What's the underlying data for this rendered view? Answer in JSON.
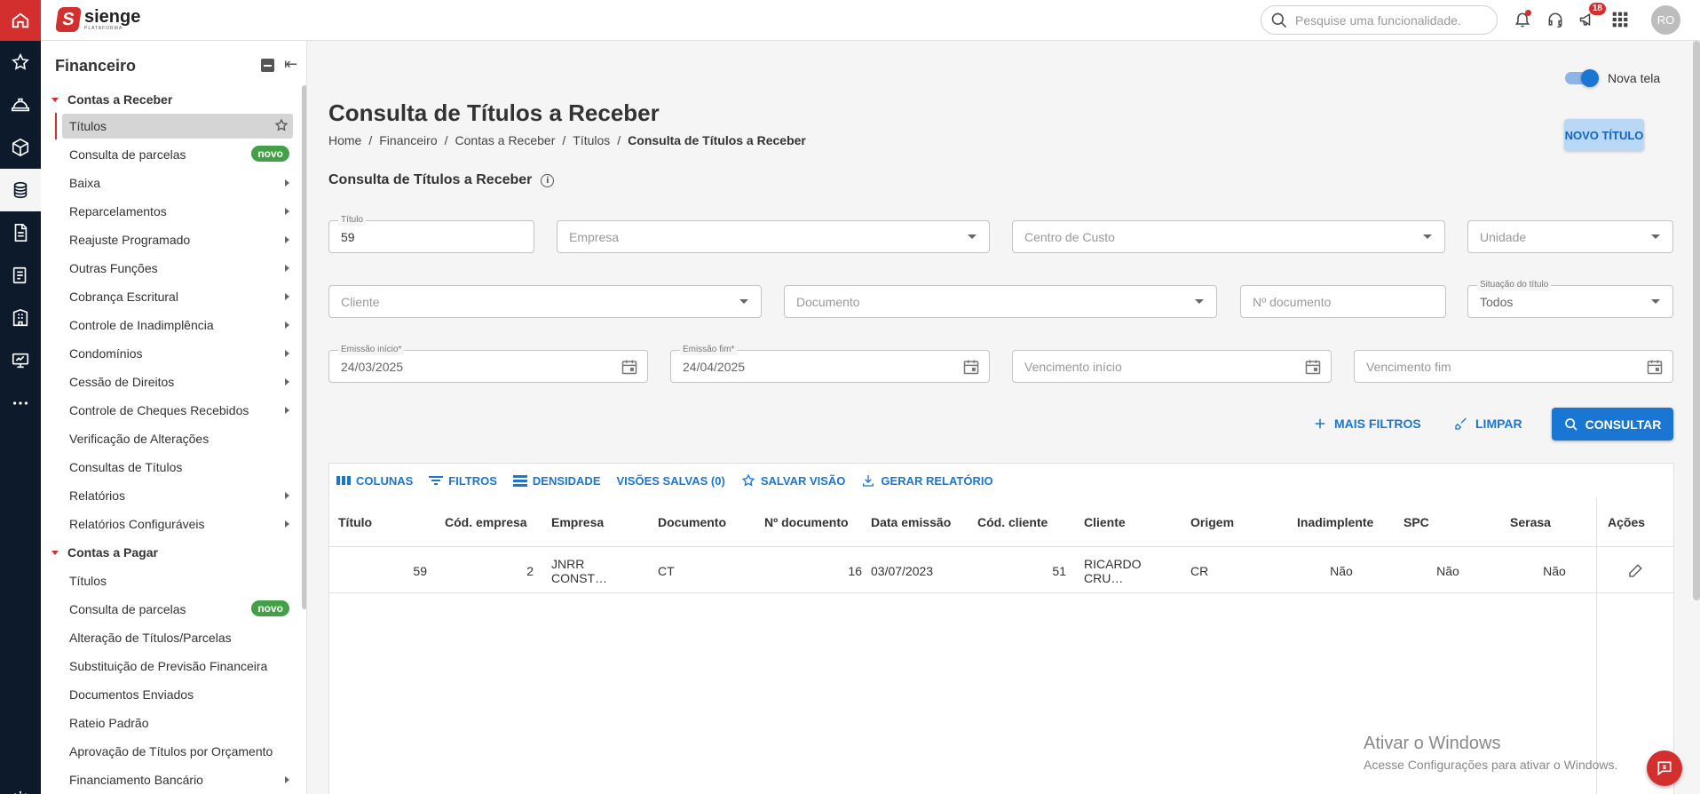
{
  "brand": {
    "name": "sienge",
    "tag": "PLATAFORMA",
    "logo_letter": "S"
  },
  "topbar": {
    "search_placeholder": "Pesquise uma funcionalidade.",
    "announcements_count": "18",
    "avatar_initials": "RO"
  },
  "sidebar": {
    "title": "Financeiro",
    "receber": {
      "label": "Contas a Receber",
      "items": [
        {
          "label": "Títulos"
        },
        {
          "label": "Consulta de parcelas",
          "badge": "novo"
        },
        {
          "label": "Baixa"
        },
        {
          "label": "Reparcelamentos"
        },
        {
          "label": "Reajuste Programado"
        },
        {
          "label": "Outras Funções"
        },
        {
          "label": "Cobrança Escritural"
        },
        {
          "label": "Controle de Inadimplência"
        },
        {
          "label": "Condomínios"
        },
        {
          "label": "Cessão de Direitos"
        },
        {
          "label": "Controle de Cheques Recebidos"
        },
        {
          "label": "Verificação de Alterações"
        },
        {
          "label": "Consultas de Títulos"
        },
        {
          "label": "Relatórios"
        },
        {
          "label": "Relatórios Configuráveis"
        }
      ]
    },
    "pagar": {
      "label": "Contas a Pagar",
      "items": [
        {
          "label": "Títulos"
        },
        {
          "label": "Consulta de parcelas",
          "badge": "novo"
        },
        {
          "label": "Alteração de Títulos/Parcelas"
        },
        {
          "label": "Substituição de Previsão Financeira"
        },
        {
          "label": "Documentos Enviados"
        },
        {
          "label": "Rateio Padrão"
        },
        {
          "label": "Aprovação de Títulos por Orçamento"
        },
        {
          "label": "Financiamento Bancário"
        }
      ]
    }
  },
  "page": {
    "toggle_label": "Nova tela",
    "title": "Consulta de Títulos a Receber",
    "breadcrumb": [
      "Home",
      "Financeiro",
      "Contas a Receber",
      "Títulos",
      "Consulta de Títulos a Receber"
    ],
    "new_button": "NOVO TÍTULO",
    "section_title": "Consulta de Títulos a Receber"
  },
  "filters": {
    "titulo": {
      "label": "Título",
      "value": "59"
    },
    "empresa": {
      "placeholder": "Empresa"
    },
    "centro_custo": {
      "placeholder": "Centro de Custo"
    },
    "unidade": {
      "placeholder": "Unidade"
    },
    "cliente": {
      "placeholder": "Cliente"
    },
    "documento": {
      "placeholder": "Documento"
    },
    "n_documento": {
      "placeholder": "Nº documento"
    },
    "situacao": {
      "label": "Situação do título",
      "value": "Todos"
    },
    "emissao_inicio": {
      "label": "Emissão início*",
      "value": "24/03/2025"
    },
    "emissao_fim": {
      "label": "Emissão fim*",
      "value": "24/04/2025"
    },
    "vencimento_inicio": {
      "placeholder": "Vencimento início"
    },
    "vencimento_fim": {
      "placeholder": "Vencimento fim"
    }
  },
  "actions": {
    "more_filters": "MAIS FILTROS",
    "clear": "LIMPAR",
    "search": "CONSULTAR"
  },
  "grid": {
    "toolbar": {
      "columns": "COLUNAS",
      "filters": "FILTROS",
      "density": "DENSIDADE",
      "saved_views": "VISÕES SALVAS (0)",
      "save_view": "SALVAR VISÃO",
      "report": "GERAR RELATÓRIO"
    },
    "headers": [
      "Título",
      "Cód. empresa",
      "Empresa",
      "Documento",
      "Nº documento",
      "Data emissão",
      "Cód. cliente",
      "Cliente",
      "Origem",
      "Inadimplente",
      "SPC",
      "Serasa",
      "Ações"
    ],
    "rows": [
      [
        "59",
        "2",
        "JNRR CONST…",
        "CT",
        "16",
        "03/07/2023",
        "51",
        "RICARDO CRU…",
        "CR",
        "Não",
        "Não",
        "Não"
      ]
    ]
  },
  "watermark": {
    "line1": "Ativar o Windows",
    "line2": "Acesse Configurações para ativar o Windows."
  },
  "colors": {
    "brand_red": "#d32f2f",
    "primary_blue": "#1976d2",
    "rail_dark": "#0d1a2b",
    "badge_green": "#43a047"
  }
}
